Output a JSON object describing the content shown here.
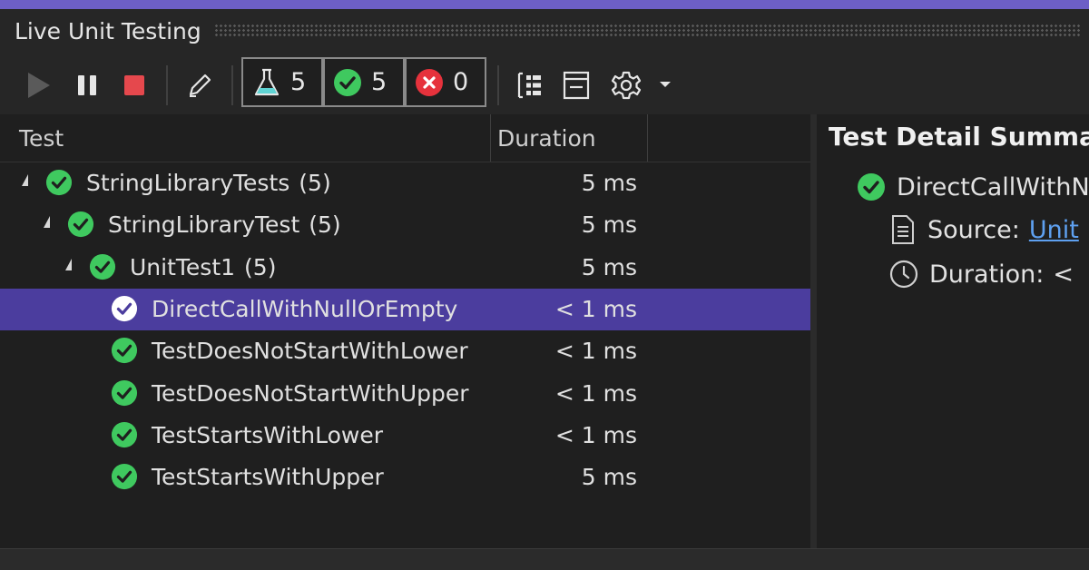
{
  "window": {
    "title": "Live Unit Testing"
  },
  "toolbar": {
    "counts": {
      "total": "5",
      "passed": "5",
      "failed": "0"
    }
  },
  "columns": {
    "test": "Test",
    "duration": "Duration"
  },
  "tree": [
    {
      "name": "StringLibraryTests",
      "count": "(5)",
      "duration": "5 ms"
    },
    {
      "name": "StringLibraryTest",
      "count": "(5)",
      "duration": "5 ms"
    },
    {
      "name": "UnitTest1",
      "count": "(5)",
      "duration": "5 ms"
    },
    {
      "name": "DirectCallWithNullOrEmpty",
      "duration": "< 1 ms",
      "selected": true
    },
    {
      "name": "TestDoesNotStartWithLower",
      "duration": "< 1 ms"
    },
    {
      "name": "TestDoesNotStartWithUpper",
      "duration": "< 1 ms"
    },
    {
      "name": "TestStartsWithLower",
      "duration": "< 1 ms"
    },
    {
      "name": "TestStartsWithUpper",
      "duration": "5 ms"
    }
  ],
  "detail": {
    "title": "Test Detail Summar",
    "test_name": "DirectCallWithN",
    "source_label": "Source:",
    "source_link": "Unit",
    "duration_label": "Duration:",
    "duration_value": "<"
  },
  "colors": {
    "accent": "#6d5fc6",
    "selected_row": "#4b3d9e",
    "pass": "#3fc95f",
    "fail": "#e6323c",
    "link": "#5ea0f0"
  },
  "icons": [
    "play-icon",
    "pause-icon",
    "stop-icon",
    "edit-icon",
    "flask-icon",
    "check-circle-icon",
    "error-circle-icon",
    "tree-view-icon",
    "panel-icon",
    "gear-icon",
    "dropdown-arrow-icon",
    "document-icon",
    "clock-icon"
  ]
}
